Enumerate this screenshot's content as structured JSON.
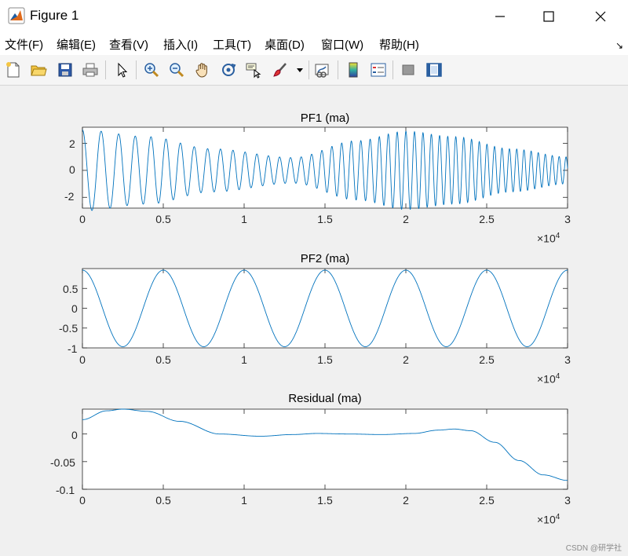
{
  "window": {
    "title": "Figure 1",
    "minimize_icon": "minimize-icon",
    "maximize_icon": "maximize-icon",
    "close_icon": "close-icon"
  },
  "menu": [
    "文件(F)",
    "编辑(E)",
    "查看(V)",
    "插入(I)",
    "工具(T)",
    "桌面(D)",
    "窗口(W)",
    "帮助(H)"
  ],
  "toolbar": {
    "icons": [
      "new-figure-icon",
      "open-file-icon",
      "save-icon",
      "print-icon",
      "pointer-icon",
      "zoom-in-icon",
      "zoom-out-icon",
      "pan-hand-icon",
      "rotate-3d-icon",
      "data-cursor-icon",
      "brush-icon",
      "brush-dropdown-icon",
      "link-plot-icon",
      "colorbar-icon",
      "legend-icon",
      "hide-plot-tools-icon",
      "show-plot-tools-icon"
    ]
  },
  "colors": {
    "line": "#0072bd",
    "axes_bg": "#ffffff",
    "figure_bg": "#f0f0f0",
    "axis_color": "#262626"
  },
  "chart_data": [
    {
      "type": "line",
      "title": "PF1 (ma)",
      "xlabel": "",
      "ylabel": "",
      "xlim": [
        0,
        30000
      ],
      "ylim": [
        -2.8,
        3.2
      ],
      "x_ticks": [
        "0",
        "0.5",
        "1",
        "1.5",
        "2",
        "2.5",
        "3"
      ],
      "y_ticks": [
        "2",
        "0",
        "-2"
      ],
      "x_exponent": "×10",
      "x_exponent_power": "4",
      "series": [
        {
          "description": "amplitude- and frequency-modulated oscillation",
          "x_range": [
            0,
            30000
          ],
          "amplitude_start": 3.0,
          "amplitude_min_near_x": 13000,
          "amplitude_max_near_x": 20000,
          "amplitude_end": 1.0,
          "cycles_approx": 47
        }
      ]
    },
    {
      "type": "line",
      "title": "PF2 (ma)",
      "xlabel": "",
      "ylabel": "",
      "xlim": [
        0,
        30000
      ],
      "ylim": [
        -1,
        1
      ],
      "x_ticks": [
        "0",
        "0.5",
        "1",
        "1.5",
        "2",
        "2.5",
        "3"
      ],
      "y_ticks": [
        "0.5",
        "0",
        "-0.5",
        "-1"
      ],
      "x_exponent": "×10",
      "x_exponent_power": "4",
      "series": [
        {
          "description": "near-constant oscillation",
          "peaks_x": [
            5000,
            10000,
            15000,
            20000,
            25000
          ],
          "troughs_x": [
            2500,
            7500,
            12500,
            17500,
            22500,
            27500
          ],
          "peak_value": 0.96,
          "trough_value": -0.97,
          "start_value": 0.72
        }
      ]
    },
    {
      "type": "line",
      "title": "Residual (ma)",
      "xlabel": "",
      "ylabel": "",
      "xlim": [
        0,
        30000
      ],
      "ylim": [
        -0.1,
        0.045
      ],
      "x_ticks": [
        "0",
        "0.5",
        "1",
        "1.5",
        "2",
        "2.5",
        "3"
      ],
      "y_ticks": [
        "0",
        "-0.05",
        "-0.1"
      ],
      "x_exponent": "×10",
      "x_exponent_power": "4",
      "series": [
        {
          "x": [
            0,
            1500,
            2500,
            4000,
            6000,
            8500,
            11000,
            13000,
            14500,
            16500,
            18500,
            20500,
            22000,
            23000,
            24000,
            25500,
            27000,
            28500,
            30000
          ],
          "y": [
            0.026,
            0.042,
            0.045,
            0.041,
            0.023,
            0.0,
            -0.004,
            -0.001,
            0.001,
            0.0,
            -0.001,
            0.001,
            0.007,
            0.009,
            0.006,
            -0.015,
            -0.048,
            -0.074,
            -0.084
          ]
        }
      ]
    }
  ],
  "watermark": "CSDN @研学社"
}
